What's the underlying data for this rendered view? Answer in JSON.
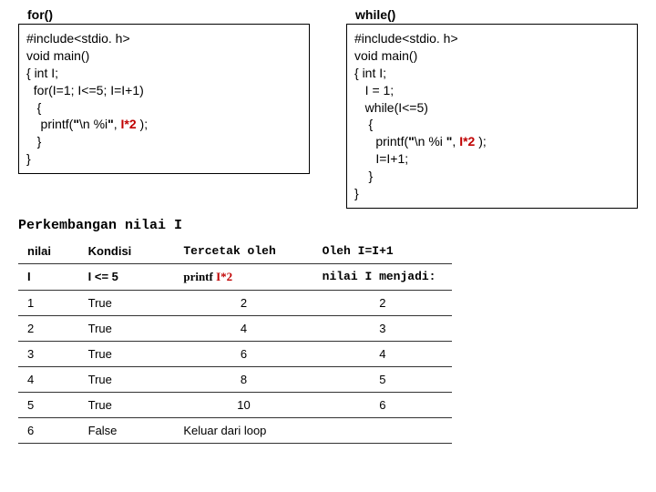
{
  "left": {
    "label": "for()",
    "l1": "#include<stdio. h>",
    "l2": "void main()",
    "l3": "{ int I;",
    "l4": "  for(I=1; I<=5; I=I+1)",
    "l5": "   {",
    "l6a": "    printf(",
    "l6q1": "\"",
    "l6b": "\\n %i",
    "l6q2": "\"",
    "l6c": ", ",
    "l6d": "I*2",
    "l6e": " );",
    "l7": "   }",
    "l8": "}"
  },
  "right": {
    "label": "while()",
    "l1": "#include<stdio. h>",
    "l2": "void main()",
    "l3": "{ int I;",
    "l4": "   I = 1;",
    "l5": "   while(I<=5)",
    "l6": "    {",
    "l7a": "      printf(",
    "l7q1": "\"",
    "l7b": "\\n %i ",
    "l7q2": "\"",
    "l7c": ", ",
    "l7d": "I*2",
    "l7e": " );",
    "l8": "      I=I+1;",
    "l9": "    }",
    "l10": "}"
  },
  "sectionTitle": "Perkembangan nilai I",
  "headers": {
    "h1a": "nilai",
    "h1b": "I",
    "h2a": "Kondisi",
    "h2b": "I <= 5",
    "h3a": "Tercetak oleh",
    "h3b_pre": "printf ",
    "h3b_hl": "I*2",
    "h4a": "Oleh I=I+1",
    "h4b": "nilai I menjadi:"
  },
  "rows": [
    {
      "i": "1",
      "cond": "True",
      "out": "2",
      "next": "2"
    },
    {
      "i": "2",
      "cond": "True",
      "out": "4",
      "next": "3"
    },
    {
      "i": "3",
      "cond": "True",
      "out": "6",
      "next": "4"
    },
    {
      "i": "4",
      "cond": "True",
      "out": "8",
      "next": "5"
    },
    {
      "i": "5",
      "cond": "True",
      "out": "10",
      "next": "6"
    },
    {
      "i": "6",
      "cond": "False",
      "out": "Keluar dari loop",
      "next": ""
    }
  ]
}
